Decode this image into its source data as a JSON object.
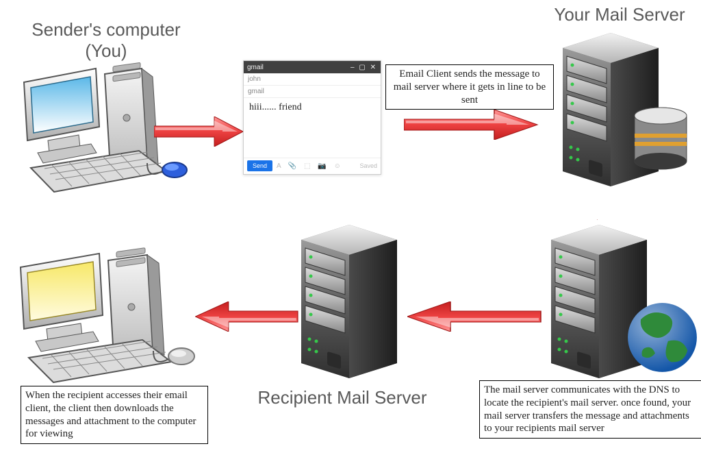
{
  "titles": {
    "sender_line1": "Sender's computer",
    "sender_line2": "(You)",
    "your_mail_server": "Your Mail Server",
    "recipient_mail_server": "Recipient Mail Server"
  },
  "captions": {
    "step1": "Email Client sends the message to mail server where it gets in line to be sent",
    "step2": "The mail server communicates with the DNS to locate the recipient's mail server. once found, your mail server transfers the message and attachments to your recipients mail server",
    "step4": "When the recipient accesses their email client, the client then downloads the messages and attachment to the computer for viewing"
  },
  "email": {
    "app": "gmail",
    "to": "john",
    "subject": "gmail",
    "body": "hiii...... friend",
    "send_label": "Send",
    "saved_label": "Saved"
  }
}
